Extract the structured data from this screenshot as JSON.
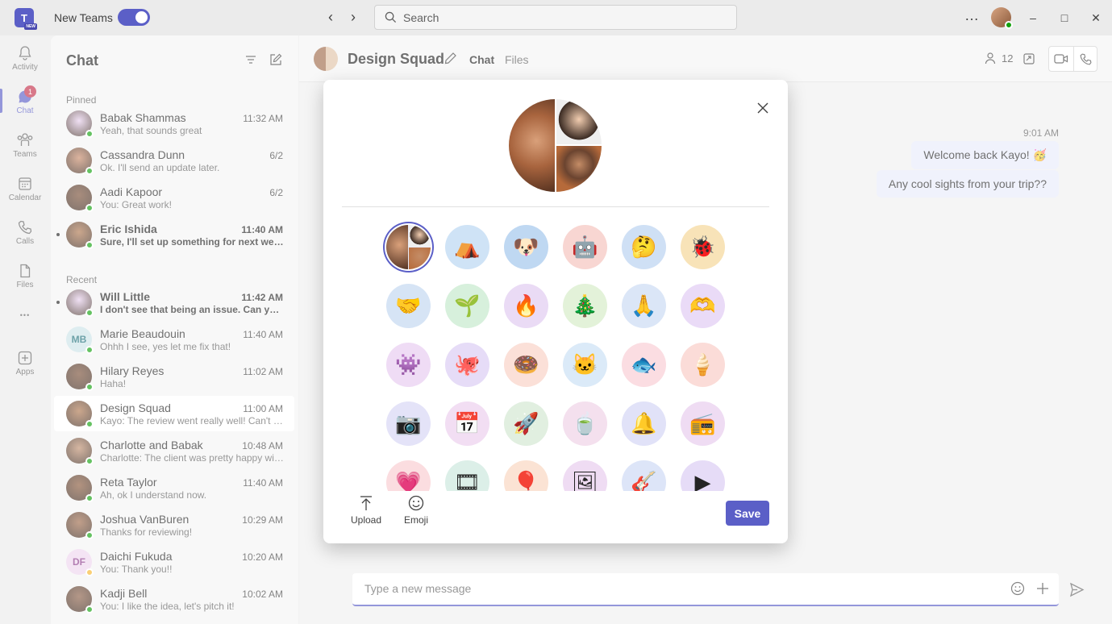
{
  "titlebar": {
    "logo_text": "T",
    "logo_badge": "NEW",
    "app_label": "New Teams",
    "search_placeholder": "Search",
    "more": "…",
    "minimize": "–",
    "maximize": "□",
    "close": "✕"
  },
  "rail": {
    "items": [
      {
        "label": "Activity",
        "icon": "bell-icon"
      },
      {
        "label": "Chat",
        "icon": "chat-icon",
        "badge": "1"
      },
      {
        "label": "Teams",
        "icon": "teams-icon"
      },
      {
        "label": "Calendar",
        "icon": "calendar-icon"
      },
      {
        "label": "Calls",
        "icon": "phone-icon"
      },
      {
        "label": "Files",
        "icon": "file-icon"
      },
      {
        "label": "",
        "icon": "more-icon"
      },
      {
        "label": "Apps",
        "icon": "apps-icon"
      }
    ],
    "more_text": "•••"
  },
  "chat_panel": {
    "title": "Chat",
    "pinned_label": "Pinned",
    "recent_label": "Recent",
    "pinned": [
      {
        "name": "Babak Shammas",
        "time": "11:32 AM",
        "preview": "Yeah, that sounds great",
        "unread": false
      },
      {
        "name": "Cassandra Dunn",
        "time": "6/2",
        "preview": "Ok. I'll send an update later.",
        "unread": false
      },
      {
        "name": "Aadi Kapoor",
        "time": "6/2",
        "preview": "You: Great work!",
        "unread": false
      },
      {
        "name": "Eric Ishida",
        "time": "11:40 AM",
        "preview": "Sure, I'll set up something for next week t...",
        "unread": true
      }
    ],
    "recent": [
      {
        "name": "Will Little",
        "time": "11:42 AM",
        "preview": "I don't see that being an issue. Can you ta...",
        "unread": true
      },
      {
        "name": "Marie Beaudouin",
        "time": "11:40 AM",
        "preview": "Ohhh I see, yes let me fix that!",
        "unread": false,
        "initials": "MB"
      },
      {
        "name": "Hilary Reyes",
        "time": "11:02 AM",
        "preview": "Haha!",
        "unread": false
      },
      {
        "name": "Design Squad",
        "time": "11:00 AM",
        "preview": "Kayo: The review went really well! Can't wai...",
        "unread": false,
        "selected": true
      },
      {
        "name": "Charlotte and Babak",
        "time": "10:48 AM",
        "preview": "Charlotte: The client was pretty happy with...",
        "unread": false
      },
      {
        "name": "Reta Taylor",
        "time": "11:40 AM",
        "preview": "Ah, ok I understand now.",
        "unread": false
      },
      {
        "name": "Joshua VanBuren",
        "time": "10:29 AM",
        "preview": "Thanks for reviewing!",
        "unread": false
      },
      {
        "name": "Daichi Fukuda",
        "time": "10:20 AM",
        "preview": "You: Thank you!!",
        "unread": false,
        "initials": "DF"
      },
      {
        "name": "Kadji Bell",
        "time": "10:02 AM",
        "preview": "You: I like the idea, let's pitch it!",
        "unread": false
      }
    ]
  },
  "main": {
    "group_title": "Design Squad",
    "tabs": [
      {
        "label": "Chat",
        "active": true
      },
      {
        "label": "Files",
        "active": false
      }
    ],
    "participants_count": "12",
    "message_time": "9:01 AM",
    "messages": [
      {
        "text": "Welcome back Kayo! 🥳"
      },
      {
        "text": "Any cool sights from your trip??"
      }
    ],
    "composer_placeholder": "Type a new message"
  },
  "dialog": {
    "close": "✕",
    "upload_label": "Upload",
    "emoji_label": "Emoji",
    "save_label": "Save",
    "icons": [
      {
        "name": "group-photo-icon",
        "glyph": "",
        "bg": "#e8eaf6"
      },
      {
        "name": "camping-tent-icon",
        "glyph": "⛺",
        "bg": "#cfe3f6"
      },
      {
        "name": "dog-face-icon",
        "glyph": "🐶",
        "bg": "#bfd8f2"
      },
      {
        "name": "robot-icon",
        "glyph": "🤖",
        "bg": "#f8d6d2"
      },
      {
        "name": "thinking-face-icon",
        "glyph": "🤔",
        "bg": "#cfe0f5"
      },
      {
        "name": "bug-icon",
        "glyph": "🐞",
        "bg": "#f8e3b8"
      },
      {
        "name": "handshake-icon",
        "glyph": "🤝",
        "bg": "#d6e4f5"
      },
      {
        "name": "seedling-hand-icon",
        "glyph": "🌱",
        "bg": "#d7f0dc"
      },
      {
        "name": "flame-hands-icon",
        "glyph": "🔥",
        "bg": "#eadbf5"
      },
      {
        "name": "tree-star-icon",
        "glyph": "🎄",
        "bg": "#e3f2d9"
      },
      {
        "name": "clasped-hands-icon",
        "glyph": "🙏",
        "bg": "#dbe6f7"
      },
      {
        "name": "heart-hands-icon",
        "glyph": "🫶",
        "bg": "#eadbf7"
      },
      {
        "name": "monster-icon",
        "glyph": "👾",
        "bg": "#efdcf5"
      },
      {
        "name": "octopus-icon",
        "glyph": "🐙",
        "bg": "#e6dcf7"
      },
      {
        "name": "donut-chef-icon",
        "glyph": "🍩",
        "bg": "#fbe0d8"
      },
      {
        "name": "cat-cup-icon",
        "glyph": "🐱",
        "bg": "#dbeaf8"
      },
      {
        "name": "fish-icon",
        "glyph": "🐟",
        "bg": "#fbdde2"
      },
      {
        "name": "ice-cream-icon",
        "glyph": "🍦",
        "bg": "#fbdcd8"
      },
      {
        "name": "camera-icon",
        "glyph": "📷",
        "bg": "#e4e3f8"
      },
      {
        "name": "calendar-sticker-icon",
        "glyph": "📅",
        "bg": "#f2def3"
      },
      {
        "name": "rocket-icon",
        "glyph": "🚀",
        "bg": "#e1efe0"
      },
      {
        "name": "tea-cup-icon",
        "glyph": "🍵",
        "bg": "#f4e0ee"
      },
      {
        "name": "bell-sticker-icon",
        "glyph": "🔔",
        "bg": "#e1e2f8"
      },
      {
        "name": "boombox-icon",
        "glyph": "📻",
        "bg": "#efdcf3"
      },
      {
        "name": "heart-sticker-icon",
        "glyph": "💗",
        "bg": "#fbdde0"
      },
      {
        "name": "film-reel-icon",
        "glyph": "🎞",
        "bg": "#dcefe8"
      },
      {
        "name": "balloon-icon",
        "glyph": "🎈",
        "bg": "#fbe3d4"
      },
      {
        "name": "picture-frame-icon",
        "glyph": "🖼",
        "bg": "#efdcf3"
      },
      {
        "name": "guitar-icon",
        "glyph": "🎸",
        "bg": "#dde5f8"
      },
      {
        "name": "video-play-icon",
        "glyph": "▶",
        "bg": "#e6dcf7"
      }
    ]
  },
  "colors": {
    "brand": "#5b5fc7",
    "presence_available": "#13a10e",
    "presence_away": "#f8b52c",
    "badge": "#c4314b"
  }
}
